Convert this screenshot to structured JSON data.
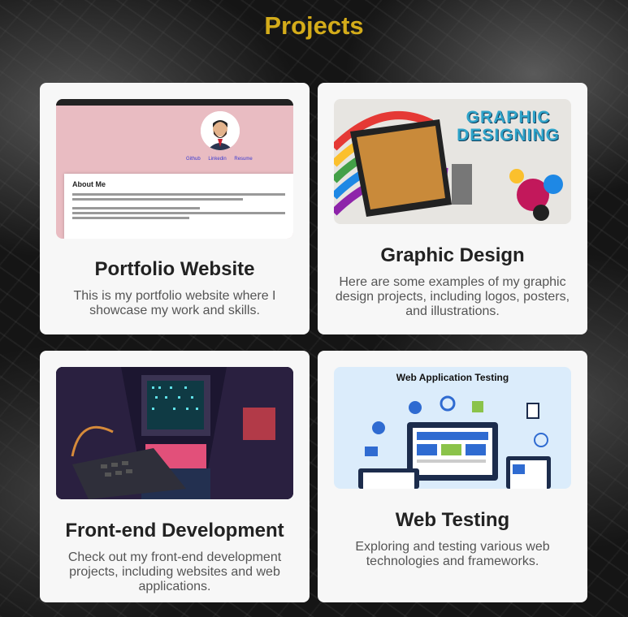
{
  "page": {
    "title": "Projects"
  },
  "projects": [
    {
      "title": "Portfolio Website",
      "description": "This is my portfolio website where I showcase my work and skills.",
      "thumb": {
        "about_heading": "About Me",
        "links": "Github Linkedin Resume"
      }
    },
    {
      "title": "Graphic Design",
      "description": "Here are some examples of my graphic design projects, including logos, posters, and illustrations.",
      "thumb": {
        "banner_line1": "GRAPHIC",
        "banner_line2": "DESIGNING"
      }
    },
    {
      "title": "Front-end Development",
      "description": "Check out my front-end development projects, including websites and web applications."
    },
    {
      "title": "Web Testing",
      "description": "Exploring and testing various web technologies and frameworks.",
      "thumb": {
        "banner": "Web Application Testing"
      }
    }
  ],
  "colors": {
    "accent": "#d4ac1a",
    "card_bg": "#f7f7f7"
  }
}
